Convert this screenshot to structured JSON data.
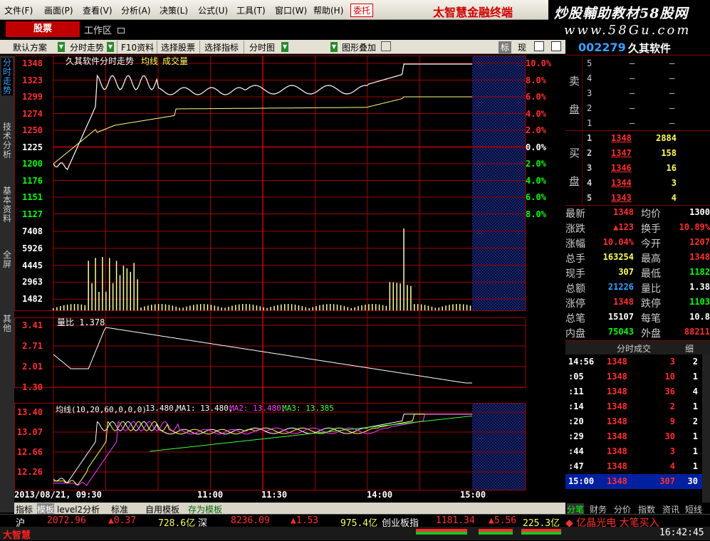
{
  "menu": {
    "items": [
      "文件(F)",
      "画面(P)",
      "查看(V)",
      "分析(A)",
      "决策(L)",
      "公式(U)",
      "工具(T)",
      "窗口(W)",
      "帮助(H)"
    ],
    "trade_button": "委托",
    "brand": "太智慧金融终端"
  },
  "watermark": {
    "line1": "炒股輔助教材58股网",
    "line2": "www.58Gu.com"
  },
  "tabs": {
    "stock": "股票",
    "workspace": "工作区"
  },
  "toolbar": {
    "scheme": "默认方案",
    "items": [
      "分时走势",
      "F10资料",
      "选择股票",
      "选择指标",
      "分时图",
      "图形叠加"
    ],
    "mark": "标",
    "now": "现"
  },
  "left_tabs": [
    "分时走势",
    "技术分析",
    "基本资料",
    "全屏",
    "其他"
  ],
  "chart": {
    "title": "久其软件分时走势",
    "legend_avg": "均线",
    "legend_vol": "成交量",
    "price_labels": [
      "1348",
      "1323",
      "1299",
      "1274",
      "1250",
      "1225",
      "1200",
      "1176",
      "1151",
      "1127"
    ],
    "pct_labels": [
      "10.0%",
      "8.0%",
      "6.0%",
      "4.0%",
      "2.0%",
      "0.0%",
      "2.0%",
      "4.0%",
      "6.0%",
      "8.0%"
    ],
    "vol_labels": [
      "7408",
      "5926",
      "4445",
      "2963",
      "1482"
    ],
    "ratio_title": "量比 1.378",
    "ratio_labels": [
      "3.41",
      "2.71",
      "2.01",
      "1.30"
    ],
    "ma_title": "均线(10,20,60,0,0,0)",
    "ma_value": "13.480,",
    "ma1": "MA1: 13.480,",
    "ma2": "MA2: 13.480,",
    "ma3": "MA3: 13.385",
    "ma_labels": [
      "13.40",
      "13.07",
      "12.66",
      "12.26"
    ],
    "time_labels": [
      "2013/08/21, 09:30",
      "11:00",
      "11:30",
      "14:00",
      "15:00"
    ],
    "colors": {
      "up": "#ff3030",
      "down": "#00ff00",
      "grid": "#a00000",
      "price": "#ffffff",
      "avg": "#ffff80",
      "volume": "#ffffa0",
      "ma2": "#ff40ff",
      "ma3": "#40ff40"
    }
  },
  "quote": {
    "code": "002279",
    "name": "久其软件",
    "sell_label": [
      "卖",
      "盘"
    ],
    "buy_label": [
      "买",
      "盘"
    ],
    "sell": [
      {
        "n": "5",
        "p": "–",
        "v": "–"
      },
      {
        "n": "4",
        "p": "–",
        "v": "–"
      },
      {
        "n": "3",
        "p": "–",
        "v": "–"
      },
      {
        "n": "2",
        "p": "–",
        "v": "–"
      },
      {
        "n": "1",
        "p": "–",
        "v": "–"
      }
    ],
    "buy": [
      {
        "n": "1",
        "p": "1348",
        "v": "2884"
      },
      {
        "n": "2",
        "p": "1347",
        "v": "158"
      },
      {
        "n": "3",
        "p": "1346",
        "v": "16"
      },
      {
        "n": "4",
        "p": "1344",
        "v": "3"
      },
      {
        "n": "5",
        "p": "1343",
        "v": "4"
      }
    ],
    "info": [
      {
        "k1": "最新",
        "v1": "1348",
        "k2": "均价",
        "v2": "1300"
      },
      {
        "k1": "涨跌",
        "v1": "▲123",
        "k2": "换手",
        "v2": "10.89%"
      },
      {
        "k1": "涨幅",
        "v1": "10.04%",
        "k2": "今开",
        "v2": "1207"
      },
      {
        "k1": "总手",
        "v1": "163254",
        "k2": "最高",
        "v2": "1348"
      },
      {
        "k1": "现手",
        "v1": "307",
        "k2": "最低",
        "v2": "1182"
      },
      {
        "k1": "总额",
        "v1": "21226",
        "k2": "量比",
        "v2": "1.38"
      },
      {
        "k1": "涨停",
        "v1": "1348",
        "k2": "跌停",
        "v2": "1103"
      },
      {
        "k1": "总笔",
        "v1": "15107",
        "k2": "每笔",
        "v2": "10.8"
      },
      {
        "k1": "内盘",
        "v1": "75043",
        "k2": "外盘",
        "v2": "88211"
      }
    ],
    "trades_title": "分时成交",
    "trades_btn": "细",
    "trades": [
      {
        "t": "14:56",
        "p": "1348",
        "v": "3",
        "c": "2"
      },
      {
        "t": ":05",
        "p": "1348",
        "v": "10",
        "c": "1"
      },
      {
        "t": ":11",
        "p": "1348",
        "v": "36",
        "c": "4"
      },
      {
        "t": ":14",
        "p": "1348",
        "v": "2",
        "c": "1"
      },
      {
        "t": ":20",
        "p": "1348",
        "v": "9",
        "c": "2"
      },
      {
        "t": ":29",
        "p": "1348",
        "v": "30",
        "c": "1"
      },
      {
        "t": ":44",
        "p": "1348",
        "v": "3",
        "c": "1"
      },
      {
        "t": ":47",
        "p": "1348",
        "v": "4",
        "c": "1"
      },
      {
        "t": "15:00",
        "p": "1348",
        "v": "307",
        "c": "30"
      }
    ],
    "bottom_tabs": [
      "分笔",
      "财务",
      "分价",
      "指数",
      "资讯",
      "短线"
    ]
  },
  "bottom_tabs": [
    "指标",
    "模板",
    "level2分析",
    "标准",
    "自用模板",
    "存为模板"
  ],
  "ticker": {
    "sh_label": "沪",
    "sh_index": "2072.96",
    "sh_change": "▲0.37",
    "sh_amount": "728.6亿",
    "sz_label": "深",
    "sz_index": "8236.09",
    "sz_change": "▲1.53",
    "sz_amount": "975.4亿",
    "cy_label": "创业板指",
    "cy_index": "1181.34",
    "cy_change": "▲5.56",
    "cy_amount": "225.3亿",
    "news": "◆ 亿晶光电 大笔买入"
  },
  "status": {
    "logo": "大智慧",
    "time": "16:42:45"
  }
}
